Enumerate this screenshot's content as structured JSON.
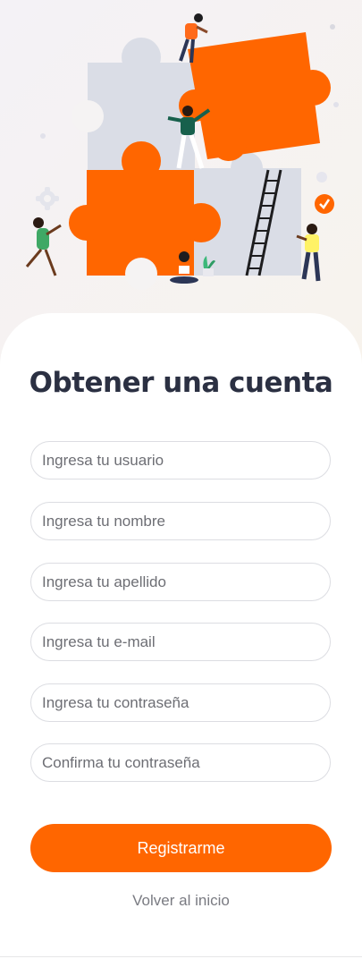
{
  "page": {
    "title": "Obtener una cuenta"
  },
  "form": {
    "fields": [
      {
        "name": "username-input",
        "placeholder": "Ingresa tu usuario"
      },
      {
        "name": "first-name-input",
        "placeholder": "Ingresa tu nombre"
      },
      {
        "name": "last-name-input",
        "placeholder": "Ingresa tu apellido"
      },
      {
        "name": "email-input",
        "placeholder": "Ingresa tu e-mail"
      },
      {
        "name": "password-input",
        "placeholder": "Ingresa tu contraseña"
      },
      {
        "name": "confirm-password-input",
        "placeholder": "Confirma tu contraseña"
      }
    ],
    "submit_label": "Registrarme",
    "back_label": "Volver al inicio"
  },
  "theme": {
    "accent": "#ff6600",
    "title_color": "#2b3042",
    "puzzle_gray": "#dadde6"
  },
  "illustration": {
    "icons": [
      "puzzle-illustration",
      "gear-icon",
      "checkmark-badge-icon",
      "ladder-icon",
      "plant-icon"
    ]
  }
}
